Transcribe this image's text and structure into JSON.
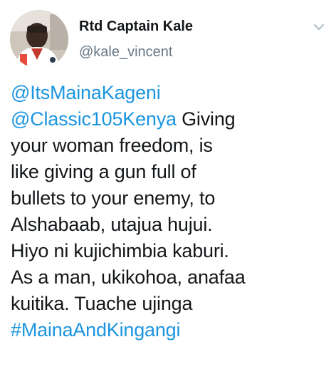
{
  "author": {
    "display_name": "Rtd Captain Kale",
    "handle": "@kale_vincent"
  },
  "tweet": {
    "lines": [
      [
        {
          "text": "@ItsMainaKageni",
          "type": "mention"
        }
      ],
      [
        {
          "text": "@Classic105Kenya",
          "type": "mention"
        },
        {
          "text": " Giving",
          "type": "text"
        }
      ],
      [
        {
          "text": "your woman freedom, is",
          "type": "text"
        }
      ],
      [
        {
          "text": "like giving a gun full of",
          "type": "text"
        }
      ],
      [
        {
          "text": "bullets to your enemy, to",
          "type": "text"
        }
      ],
      [
        {
          "text": "Alshabaab, utajua hujui.",
          "type": "text"
        }
      ],
      [
        {
          "text": "Hiyo ni kujichimbia kaburi.",
          "type": "text"
        }
      ],
      [
        {
          "text": "As a man, ukikohoa, anafaa",
          "type": "text"
        }
      ],
      [
        {
          "text": "kuitika. Tuache ujinga",
          "type": "text"
        }
      ],
      [
        {
          "text": "#MainaAndKingangi",
          "type": "hashtag"
        }
      ]
    ]
  },
  "icons": {
    "menu": "chevron-down-icon",
    "avatar": "avatar"
  },
  "colors": {
    "link": "#1b95e0",
    "text": "#14171a",
    "secondary": "#657786",
    "chevron": "#aab8c2"
  }
}
